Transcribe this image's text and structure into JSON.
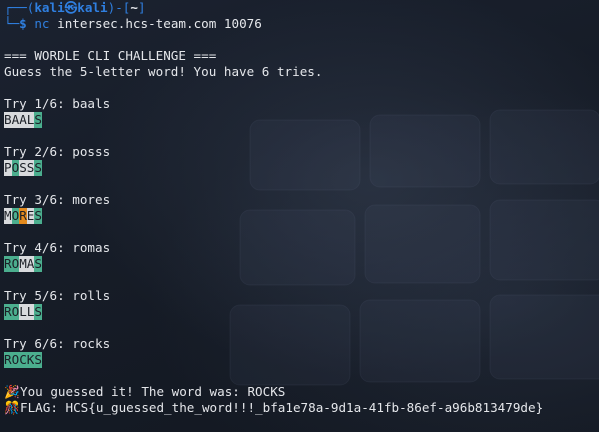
{
  "prompt": {
    "user_host": "kali㉿kali",
    "dir": "~",
    "command_name": "nc",
    "command_args": "intersec.hcs-team.com 10076"
  },
  "header": {
    "title": "=== WORDLE CLI CHALLENGE ===",
    "subtitle": "Guess the 5-letter word! You have 6 tries."
  },
  "tries": [
    {
      "label": "Try 1/6: baals",
      "result": [
        {
          "letter": "B",
          "status": "gray"
        },
        {
          "letter": "A",
          "status": "gray"
        },
        {
          "letter": "A",
          "status": "gray"
        },
        {
          "letter": "L",
          "status": "gray"
        },
        {
          "letter": "S",
          "status": "green"
        }
      ]
    },
    {
      "label": "Try 2/6: posss",
      "result": [
        {
          "letter": "P",
          "status": "gray"
        },
        {
          "letter": "O",
          "status": "green"
        },
        {
          "letter": "S",
          "status": "gray"
        },
        {
          "letter": "S",
          "status": "gray"
        },
        {
          "letter": "S",
          "status": "green"
        }
      ]
    },
    {
      "label": "Try 3/6: mores",
      "result": [
        {
          "letter": "M",
          "status": "gray"
        },
        {
          "letter": "O",
          "status": "green"
        },
        {
          "letter": "R",
          "status": "orange"
        },
        {
          "letter": "E",
          "status": "gray"
        },
        {
          "letter": "S",
          "status": "green"
        }
      ]
    },
    {
      "label": "Try 4/6: romas",
      "result": [
        {
          "letter": "R",
          "status": "green"
        },
        {
          "letter": "O",
          "status": "green"
        },
        {
          "letter": "M",
          "status": "gray"
        },
        {
          "letter": "A",
          "status": "gray"
        },
        {
          "letter": "S",
          "status": "green"
        }
      ]
    },
    {
      "label": "Try 5/6: rolls",
      "result": [
        {
          "letter": "R",
          "status": "green"
        },
        {
          "letter": "O",
          "status": "green"
        },
        {
          "letter": "L",
          "status": "gray"
        },
        {
          "letter": "L",
          "status": "gray"
        },
        {
          "letter": "S",
          "status": "green"
        }
      ]
    },
    {
      "label": "Try 6/6: rocks",
      "result": [
        {
          "letter": "R",
          "status": "green"
        },
        {
          "letter": "O",
          "status": "green"
        },
        {
          "letter": "C",
          "status": "green"
        },
        {
          "letter": "K",
          "status": "green"
        },
        {
          "letter": "S",
          "status": "green"
        }
      ]
    }
  ],
  "footer": {
    "success_text": "You guessed it! The word was: ROCKS",
    "flag_text": "FLAG: HCS{u_guessed_the_word!!!_bfa1e78a-9d1a-41fb-86ef-a96b813479de}"
  },
  "icons": {
    "success": "party-popper-icon",
    "flag": "trophy-icon"
  },
  "colors": {
    "background": "#141a24",
    "prompt_blue": "#2f7fe0",
    "text": "#e4e6ea",
    "tile_gray": "#d8dadd",
    "tile_green": "#4bae8e",
    "tile_orange": "#e38a1e"
  }
}
